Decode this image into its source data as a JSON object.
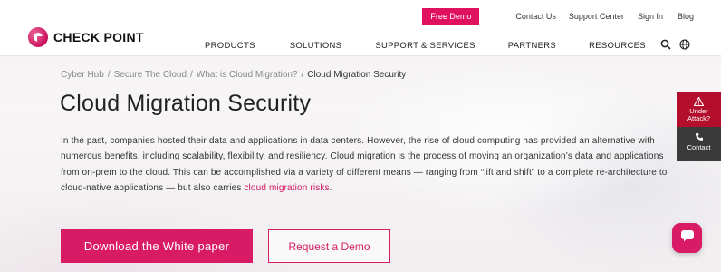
{
  "header": {
    "logo_text": "CHECK POINT",
    "utility": {
      "demo_label": "Free Demo",
      "links": [
        "Contact Us",
        "Support Center",
        "Sign In",
        "Blog"
      ]
    },
    "nav": [
      "PRODUCTS",
      "SOLUTIONS",
      "SUPPORT & SERVICES",
      "PARTNERS",
      "RESOURCES"
    ]
  },
  "breadcrumb": [
    "Cyber Hub",
    "Secure The Cloud",
    "What is Cloud Migration?",
    "Cloud Migration Security"
  ],
  "page": {
    "title": "Cloud Migration Security",
    "body_text": "In the past, companies hosted their data and applications in data centers. However, the rise of cloud computing has provided an alternative with numerous benefits, including scalability, flexibility, and resiliency. Cloud migration is the process of moving an organization’s data and applications from on-prem to the cloud. This can be accomplished via a variety of different means — ranging from “lift and shift” to a complete re-architecture to cloud-native applications — but also carries ",
    "body_link": "cloud migration risks",
    "body_end": ".",
    "primary_button": "Download the White paper",
    "secondary_button": "Request a Demo"
  },
  "side": {
    "under_attack_line1": "Under",
    "under_attack_line2": "Attack?",
    "contact": "Contact"
  },
  "icons": {
    "search": "search-icon",
    "globe": "globe-icon",
    "warning": "warning-icon",
    "phone": "phone-icon",
    "chat": "chat-icon"
  },
  "colors": {
    "brand": "#d81b64",
    "alert": "#b30f2c",
    "dark": "#3a3a3a"
  }
}
